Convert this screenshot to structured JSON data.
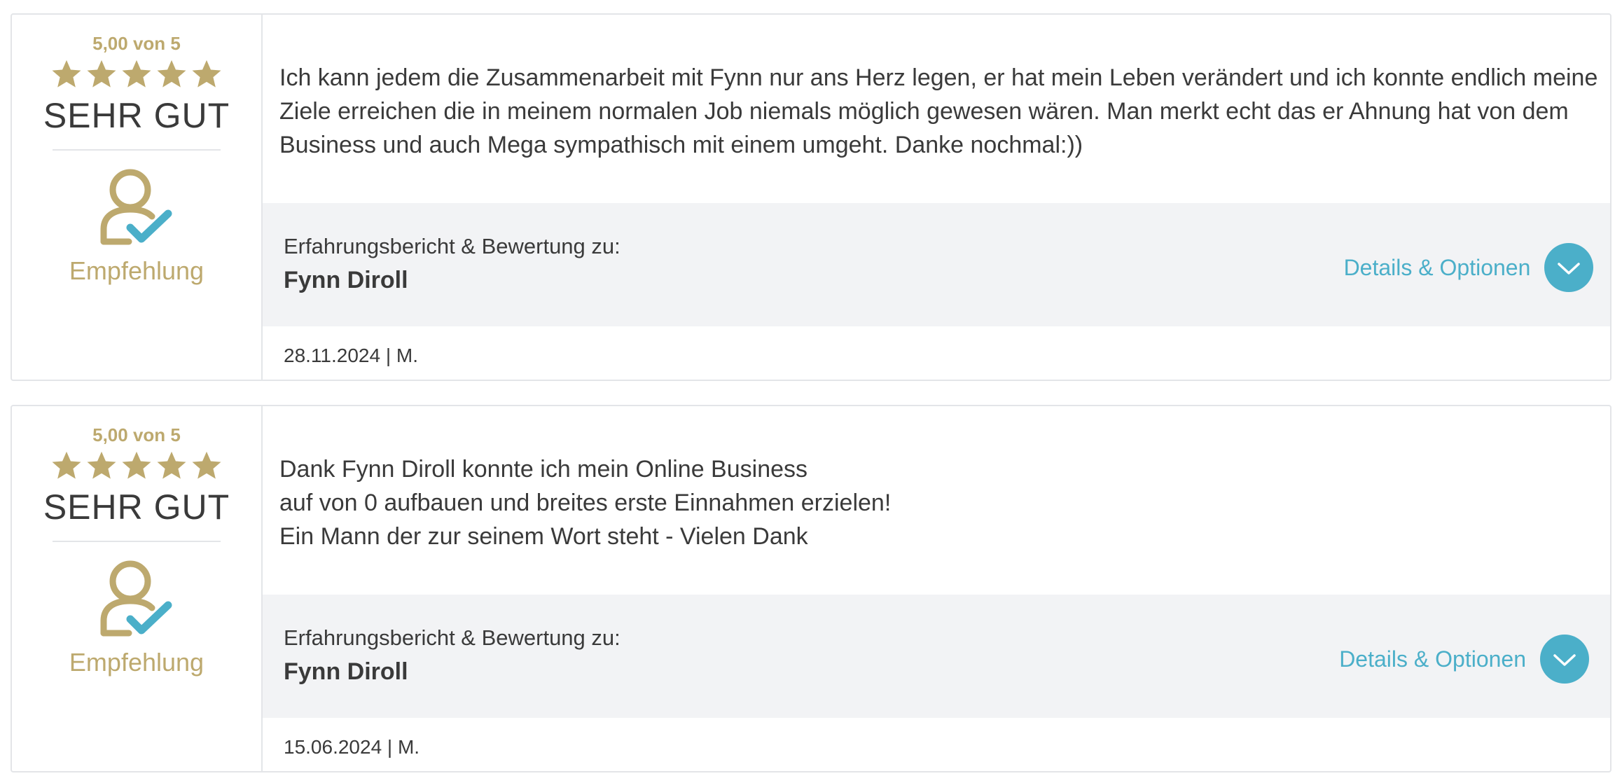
{
  "colors": {
    "gold": "#bda96e",
    "accent": "#4bafc9",
    "border": "#e3e5e8",
    "panel": "#f2f3f5",
    "text": "#3a3a3a"
  },
  "reviews": [
    {
      "score": "5,00 von 5",
      "stars": 5,
      "grade": "SEHR GUT",
      "recommend_icon": "user-check-icon",
      "recommend_label": "Empfehlung",
      "text_lines": [
        "Ich kann jedem die Zusammenarbeit mit Fynn nur ans Herz legen, er hat mein Leben verändert und ich konnte endlich meine",
        "Ziele erreichen die in meinem normalen Job niemals möglich gewesen wären. Man merkt echt das er Ahnung hat von dem",
        "Business und auch Mega sympathisch mit einem umgeht. Danke nochmal:))"
      ],
      "subject_caption": "Erfahrungsbericht & Bewertung zu:",
      "subject_name": "Fynn Diroll",
      "details_label": "Details & Optionen",
      "details_icon": "chevron-down-icon",
      "meta": "28.11.2024 | M."
    },
    {
      "score": "5,00 von 5",
      "stars": 5,
      "grade": "SEHR GUT",
      "recommend_icon": "user-check-icon",
      "recommend_label": "Empfehlung",
      "text_lines": [
        "Dank Fynn Diroll konnte ich mein Online Business",
        "auf von 0 aufbauen und breites erste Einnahmen erzielen!",
        "Ein Mann der zur seinem Wort steht - Vielen Dank"
      ],
      "subject_caption": "Erfahrungsbericht & Bewertung zu:",
      "subject_name": "Fynn Diroll",
      "details_label": "Details & Optionen",
      "details_icon": "chevron-down-icon",
      "meta": "15.06.2024 | M."
    }
  ]
}
